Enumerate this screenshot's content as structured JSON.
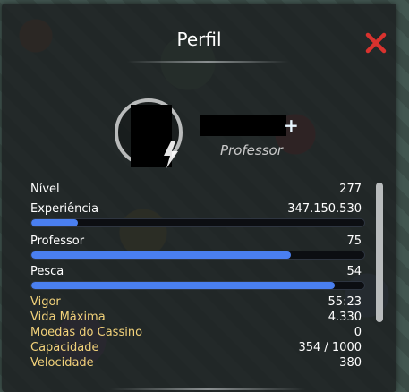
{
  "window": {
    "title": "Perfil"
  },
  "profile": {
    "role": "Professor",
    "add_icon": "plus-icon"
  },
  "stats": [
    {
      "label": "Nível",
      "value": "277"
    },
    {
      "label": "Experiência",
      "value": "347.150.530",
      "progress": 0.14
    },
    {
      "label": "Professor",
      "value": "75",
      "progress": 0.78
    },
    {
      "label": "Pesca",
      "value": "54",
      "progress": 0.91
    },
    {
      "label": "Vigor",
      "value": "55:23"
    },
    {
      "label": "Vida Máxima",
      "value": "4.330"
    },
    {
      "label": "Moedas do Cassino",
      "value": "0"
    },
    {
      "label": "Capacidade",
      "value": "354 / 1000"
    },
    {
      "label": "Velocidade",
      "value": "380"
    }
  ],
  "colors": {
    "accent_bar": "#4a7ff0",
    "close": "#d9322e",
    "label_gold": "#f2d27a"
  }
}
